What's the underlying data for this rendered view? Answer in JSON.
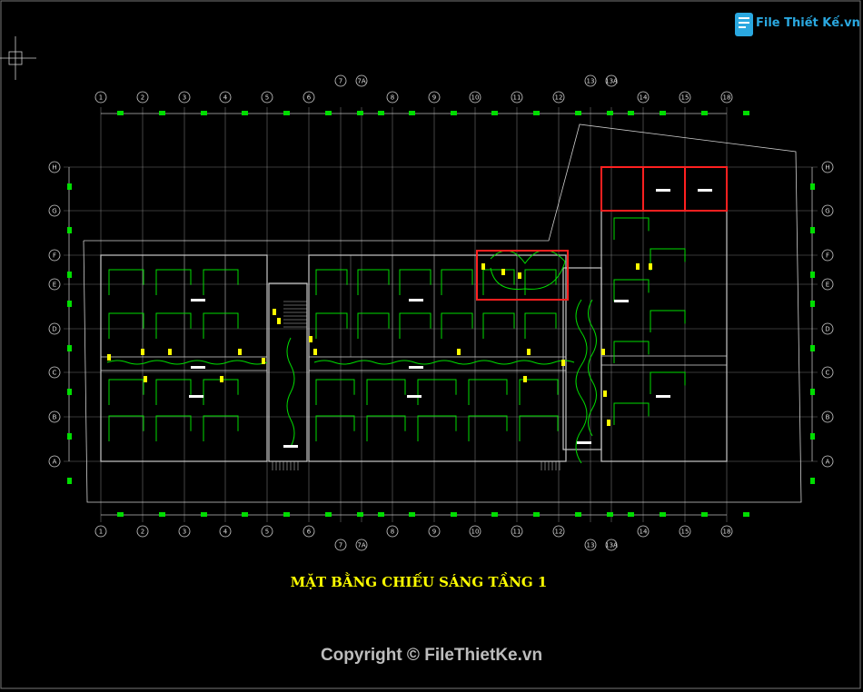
{
  "brand": {
    "logo_text": "File Thiết Kế.vn",
    "accent": "#2aa8e0"
  },
  "drawing": {
    "title": "MẶT BẰNG CHIẾU SÁNG TẦNG 1",
    "column_grid_labels": [
      "1",
      "2",
      "3",
      "4",
      "5",
      "6",
      "7",
      "7A",
      "8",
      "9",
      "10",
      "11",
      "12",
      "13",
      "13A",
      "14",
      "15",
      "18"
    ],
    "row_grid_labels": [
      "H",
      "G",
      "F",
      "E",
      "D",
      "C",
      "B",
      "A"
    ],
    "colors": {
      "background": "#000000",
      "grid": "#9a9a9a",
      "walls": "#c8c8c8",
      "lighting_circuit": "#00dd00",
      "fixtures": "#ffff00",
      "highlight": "#ff2020",
      "title": "#ffff00"
    }
  },
  "footer": {
    "copyright": "Copyright © FileThietKe.vn"
  }
}
